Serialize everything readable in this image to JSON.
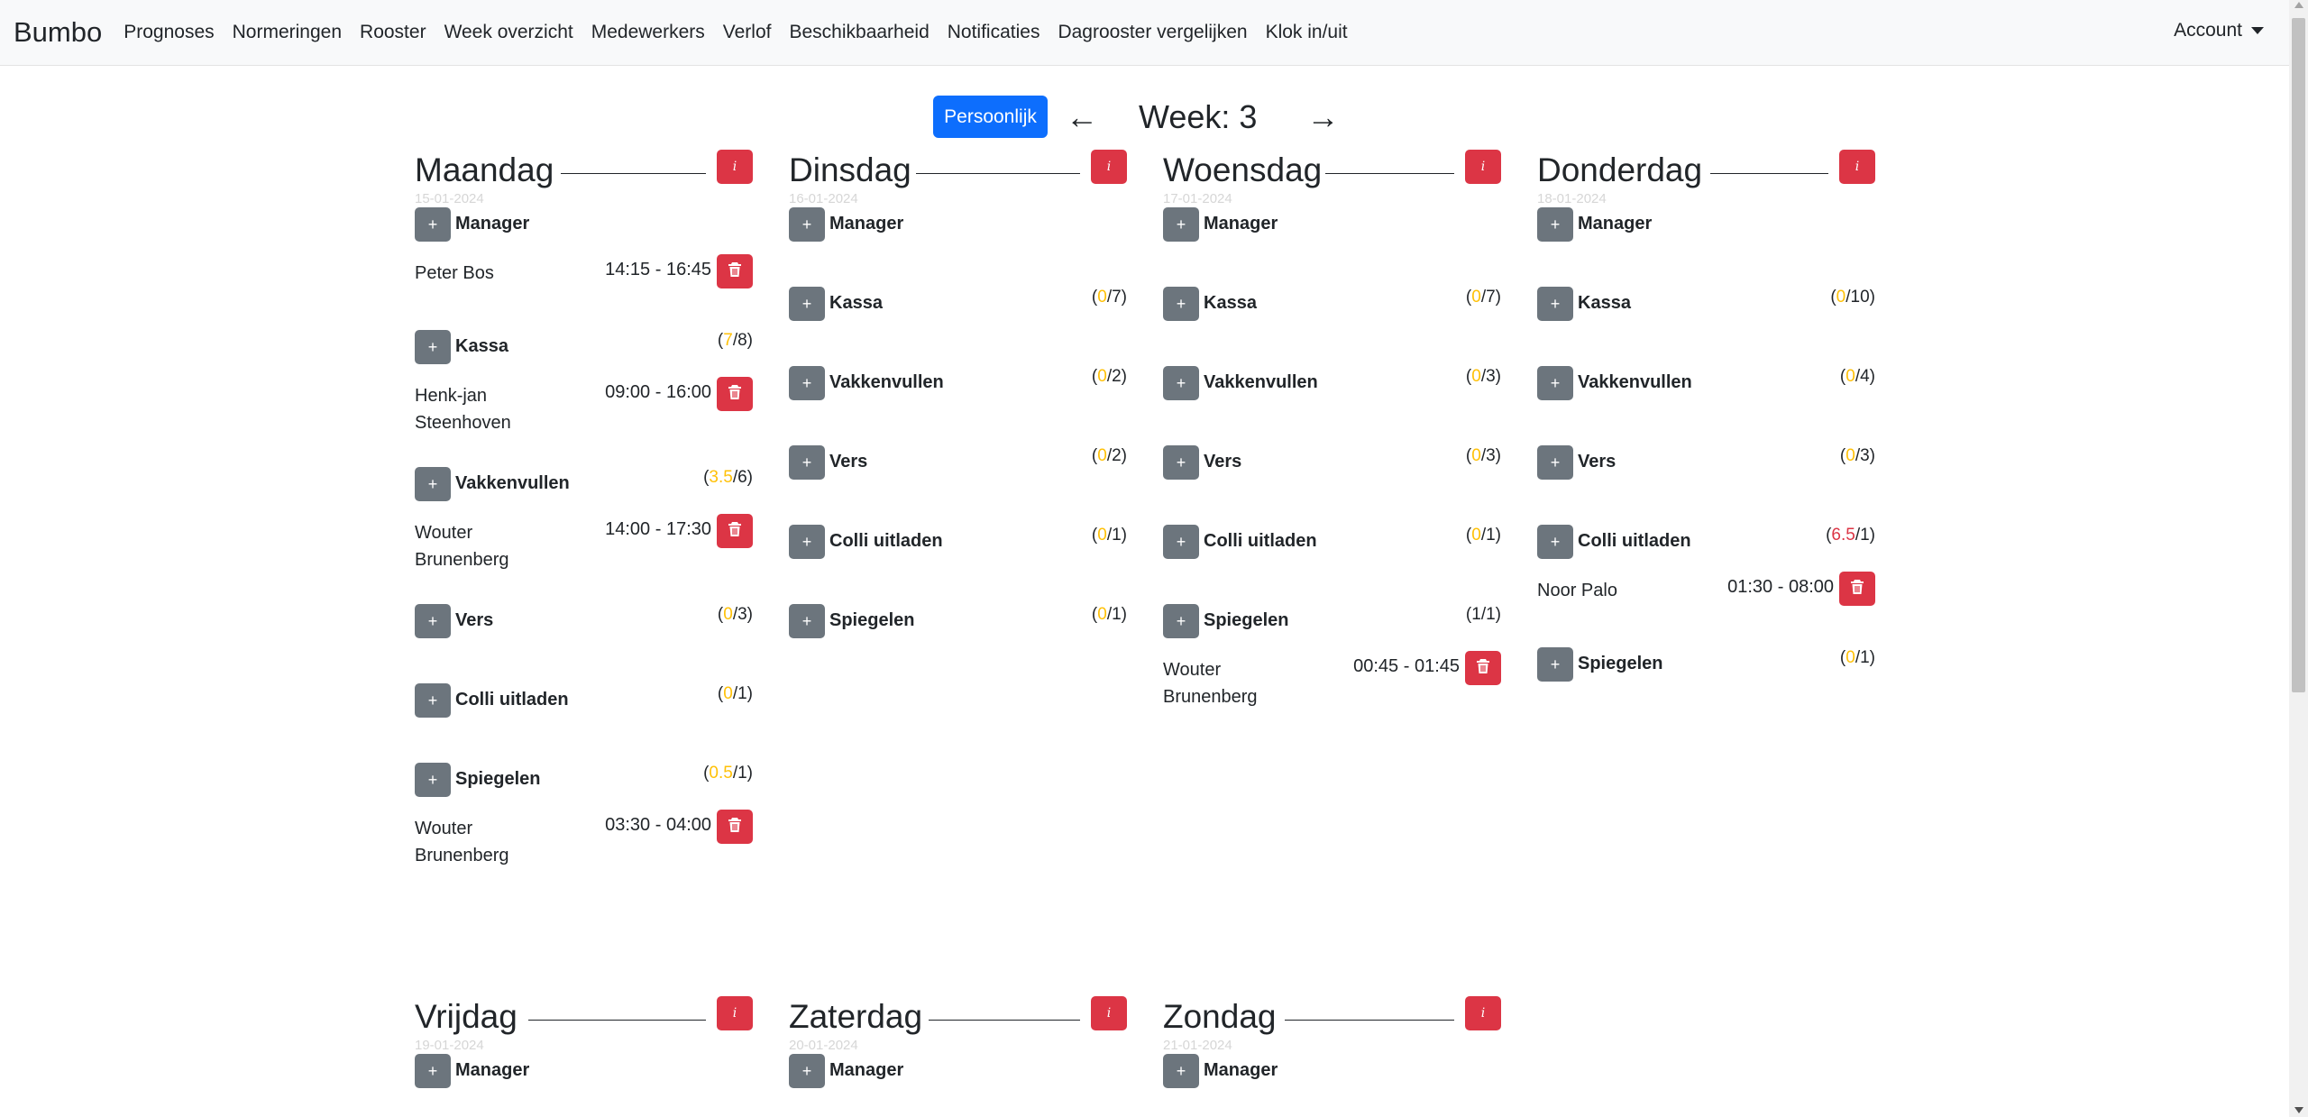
{
  "nav": {
    "brand": "Bumbo",
    "items": [
      "Prognoses",
      "Normeringen",
      "Rooster",
      "Week overzicht",
      "Medewerkers",
      "Verlof",
      "Beschikbaarheid",
      "Notificaties",
      "Dagrooster vergelijken",
      "Klok in/uit"
    ],
    "account": "Account"
  },
  "week": {
    "button": "Persoonlijk",
    "prev": "←",
    "label": "Week: 3",
    "next": "→"
  },
  "info_label": "i",
  "plus_label": "+",
  "days": [
    {
      "name": "Maandag",
      "date": "15-01-2024",
      "depts": [
        {
          "name": "Manager",
          "count_open": "",
          "count_value": "",
          "count_total": "",
          "shifts": [
            {
              "name": "Peter Bos",
              "time": "14:15 - 16:45"
            }
          ]
        },
        {
          "name": "Kassa",
          "count_open": "(",
          "count_value": "7",
          "count_total": "/8)",
          "shifts": [
            {
              "name": "Henk-jan Steenhoven",
              "time": "09:00 - 16:00"
            }
          ]
        },
        {
          "name": "Vakkenvullen",
          "count_open": "(",
          "count_value": "3.5",
          "count_total": "/6)",
          "shifts": [
            {
              "name": "Wouter Brunenberg",
              "time": "14:00 - 17:30"
            }
          ]
        },
        {
          "name": "Vers",
          "count_open": "(",
          "count_value": "0",
          "count_total": "/3)",
          "shifts": []
        },
        {
          "name": "Colli uitladen",
          "count_open": "(",
          "count_value": "0",
          "count_total": "/1)",
          "shifts": []
        },
        {
          "name": "Spiegelen",
          "count_open": "(",
          "count_value": "0.5",
          "count_total": "/1)",
          "shifts": [
            {
              "name": "Wouter Brunenberg",
              "time": "03:30 - 04:00"
            }
          ]
        }
      ]
    },
    {
      "name": "Dinsdag",
      "date": "16-01-2024",
      "depts": [
        {
          "name": "Manager",
          "count_open": "",
          "count_value": "",
          "count_total": "",
          "shifts": []
        },
        {
          "name": "Kassa",
          "count_open": "(",
          "count_value": "0",
          "count_total": "/7)",
          "shifts": []
        },
        {
          "name": "Vakkenvullen",
          "count_open": "(",
          "count_value": "0",
          "count_total": "/2)",
          "shifts": []
        },
        {
          "name": "Vers",
          "count_open": "(",
          "count_value": "0",
          "count_total": "/2)",
          "shifts": []
        },
        {
          "name": "Colli uitladen",
          "count_open": "(",
          "count_value": "0",
          "count_total": "/1)",
          "shifts": []
        },
        {
          "name": "Spiegelen",
          "count_open": "(",
          "count_value": "0",
          "count_total": "/1)",
          "shifts": []
        }
      ]
    },
    {
      "name": "Woensdag",
      "date": "17-01-2024",
      "depts": [
        {
          "name": "Manager",
          "count_open": "",
          "count_value": "",
          "count_total": "",
          "shifts": []
        },
        {
          "name": "Kassa",
          "count_open": "(",
          "count_value": "0",
          "count_total": "/7)",
          "shifts": []
        },
        {
          "name": "Vakkenvullen",
          "count_open": "(",
          "count_value": "0",
          "count_total": "/3)",
          "shifts": []
        },
        {
          "name": "Vers",
          "count_open": "(",
          "count_value": "0",
          "count_total": "/3)",
          "shifts": []
        },
        {
          "name": "Colli uitladen",
          "count_open": "(",
          "count_value": "0",
          "count_total": "/1)",
          "shifts": []
        },
        {
          "name": "Spiegelen",
          "count_open": "(",
          "count_value": "1",
          "count_total": "/1)",
          "shifts": [
            {
              "name": "Wouter Brunenberg",
              "time": "00:45 - 01:45"
            }
          ]
        }
      ]
    },
    {
      "name": "Donderdag",
      "date": "18-01-2024",
      "depts": [
        {
          "name": "Manager",
          "count_open": "",
          "count_value": "",
          "count_total": "",
          "shifts": []
        },
        {
          "name": "Kassa",
          "count_open": "(",
          "count_value": "0",
          "count_total": "/10)",
          "shifts": []
        },
        {
          "name": "Vakkenvullen",
          "count_open": "(",
          "count_value": "0",
          "count_total": "/4)",
          "shifts": []
        },
        {
          "name": "Vers",
          "count_open": "(",
          "count_value": "0",
          "count_total": "/3)",
          "shifts": []
        },
        {
          "name": "Colli uitladen",
          "count_open": "(",
          "count_value": "6.5",
          "count_total": "/1)",
          "shifts": [
            {
              "name": "Noor Palo",
              "time": "01:30 - 08:00"
            }
          ]
        },
        {
          "name": "Spiegelen",
          "count_open": "(",
          "count_value": "0",
          "count_total": "/1)",
          "shifts": []
        }
      ]
    },
    {
      "name": "Vrijdag",
      "date": "19-01-2024",
      "depts": [
        {
          "name": "Manager",
          "count_open": "",
          "count_value": "",
          "count_total": "",
          "shifts": []
        }
      ]
    },
    {
      "name": "Zaterdag",
      "date": "20-01-2024",
      "depts": [
        {
          "name": "Manager",
          "count_open": "",
          "count_value": "",
          "count_total": "",
          "shifts": []
        }
      ]
    },
    {
      "name": "Zondag",
      "date": "21-01-2024",
      "depts": [
        {
          "name": "Manager",
          "count_open": "",
          "count_value": "",
          "count_total": "",
          "shifts": []
        }
      ]
    }
  ],
  "colors": {
    "primary": "#0d6efd",
    "danger": "#dc3545",
    "secondary": "#6c757d",
    "warning": "#ffc107",
    "count_dark": "#212529"
  }
}
